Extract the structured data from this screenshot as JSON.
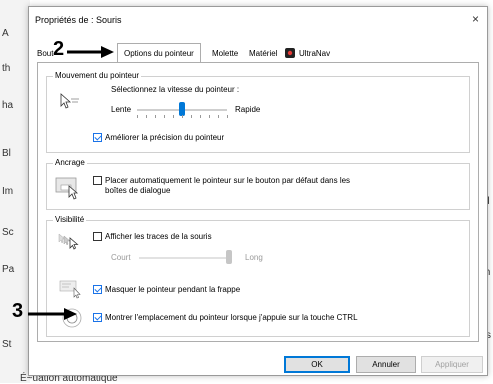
{
  "background": {
    "left_fragments": [
      "A",
      "th",
      "ha",
      "Bl",
      "Im",
      "Sc",
      "Pa",
      "St"
    ],
    "right_fragments": [
      "d",
      "th",
      "s"
    ],
    "bottom_text": "É~uation automatique"
  },
  "dialog": {
    "title": "Propriétés de : Souris",
    "close_label": "×",
    "tabs": [
      {
        "label": "Bout"
      },
      {
        "label": "Options du pointeur",
        "active": true
      },
      {
        "label": "Molette"
      },
      {
        "label": "Matériel"
      },
      {
        "label": "UltraNav"
      }
    ]
  },
  "motion": {
    "legend": "Mouvement du pointeur",
    "speed_label": "Sélectionnez la vitesse du pointeur :",
    "slow": "Lente",
    "fast": "Rapide",
    "speed_value": 0.5,
    "precision_label": "Améliorer la précision du pointeur",
    "precision_checked": true
  },
  "snap": {
    "legend": "Ancrage",
    "label_line1": "Placer automatiquement le pointeur sur le bouton par défaut dans les",
    "label_line2": "boîtes de dialogue",
    "checked": false
  },
  "visibility": {
    "legend": "Visibilité",
    "trails_label": "Afficher les traces de la souris",
    "trails_checked": false,
    "short": "Court",
    "long": "Long",
    "hide_label": "Masquer le pointeur pendant la frappe",
    "hide_checked": true,
    "ctrl_label": "Montrer l'emplacement du pointeur lorsque j'appuie sur la touche CTRL",
    "ctrl_checked": true
  },
  "buttons": {
    "ok": "OK",
    "cancel": "Annuler",
    "apply": "Appliquer"
  },
  "annotations": {
    "marker2": "2",
    "marker3": "3"
  },
  "colors": {
    "accent": "#0078d7",
    "check": "#1a73e8",
    "disabled": "#a0a0a0"
  }
}
